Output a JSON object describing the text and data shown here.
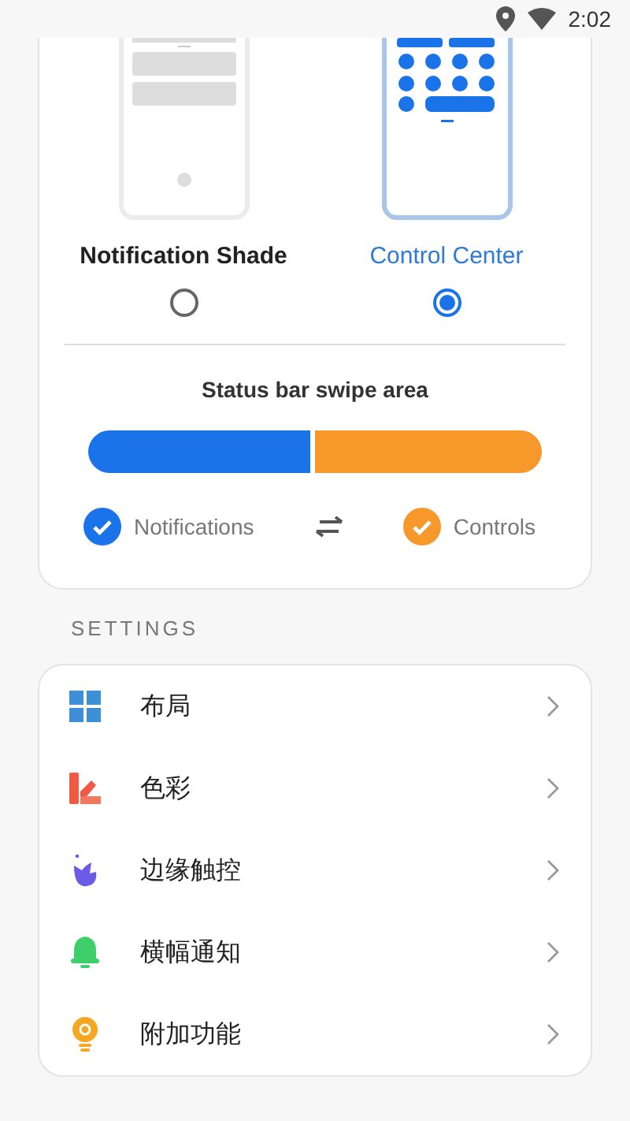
{
  "status_bar": {
    "time": "2:02"
  },
  "modes": [
    {
      "kind": "shade",
      "label": "Notification Shade",
      "selected": false
    },
    {
      "kind": "control",
      "label": "Control Center",
      "selected": true
    }
  ],
  "swipe_area": {
    "title": "Status bar swipe area",
    "level": 0.49,
    "legend": [
      {
        "label": "Notifications",
        "color": "#1a73e8"
      },
      {
        "label": "Controls",
        "color": "#f7992a"
      }
    ]
  },
  "settings": {
    "header": "SETTINGS",
    "items": [
      {
        "kind": "layout",
        "label": "布局"
      },
      {
        "kind": "color",
        "label": "色彩"
      },
      {
        "kind": "edge",
        "label": "边缘触控"
      },
      {
        "kind": "banner",
        "label": "横幅通知"
      },
      {
        "kind": "extra",
        "label": "附加功能"
      }
    ]
  }
}
